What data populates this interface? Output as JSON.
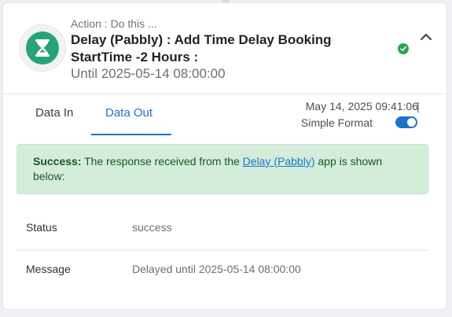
{
  "step": {
    "action_label": "Action : Do this ...",
    "title": "Delay (Pabbly) : Add Time Delay Booking StartTime -2 Hours :",
    "subtitle": "Until 2025-05-14 08:00:00",
    "app_icon": "hourglass-icon",
    "status_icon": "check-circle-icon",
    "collapse_icon": "chevron-up-icon"
  },
  "tabs": [
    {
      "label": "Data In",
      "active": false
    },
    {
      "label": "Data Out",
      "active": true
    }
  ],
  "meta": {
    "timestamp": "May 14, 2025 09:41:06",
    "separator": "|",
    "format_label": "Simple Format",
    "format_enabled": true
  },
  "alert": {
    "strong": "Success:",
    "text_before": " The response received from the ",
    "link": "Delay (Pabbly)",
    "text_after": " app is shown below:"
  },
  "output": [
    {
      "key": "Status",
      "value": "success"
    },
    {
      "key": "Message",
      "value": "Delayed until 2025-05-14 08:00:00"
    }
  ],
  "colors": {
    "accent": "#1a73c9",
    "success": "#28a745",
    "app_brand": "#27a37a",
    "alert_bg": "#d4eddb"
  }
}
